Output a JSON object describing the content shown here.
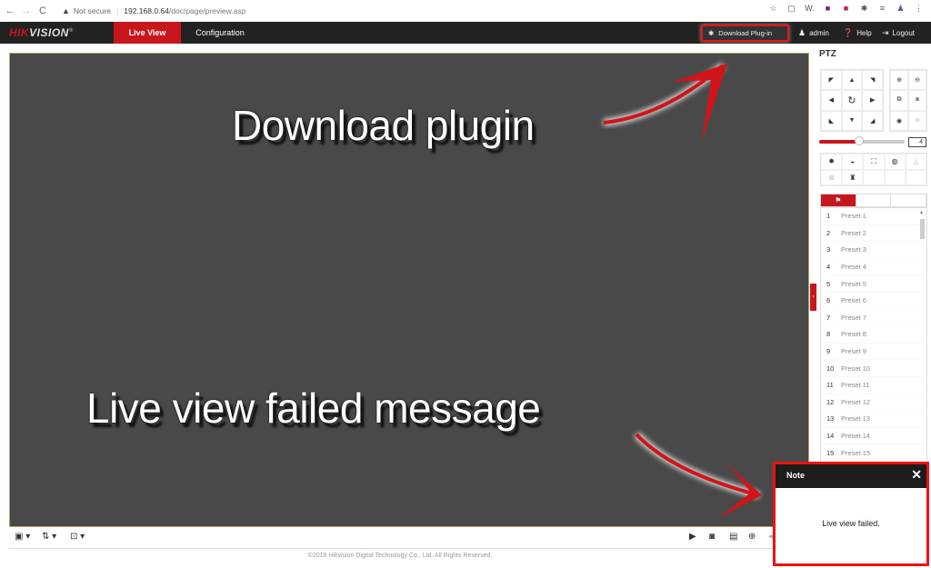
{
  "browser": {
    "back_icon": "←",
    "forward_icon": "→",
    "reload_icon": "C",
    "security_label": "Not secure",
    "url_host": "192.168.0.64",
    "url_path": "/doc/page/preview.asp",
    "extensions": [
      "☆",
      "▢",
      "W.",
      "■",
      "■",
      "✱",
      "≡",
      "♟",
      "⋮"
    ]
  },
  "header": {
    "logo_red": "HIK",
    "logo_rest": "VISION",
    "logo_reg": "®",
    "tabs": [
      {
        "label": "Live View",
        "active": true
      },
      {
        "label": "Configuration",
        "active": false
      }
    ],
    "download_plugin": "Download Plug-in",
    "user": "admin",
    "help": "Help",
    "logout": "Logout"
  },
  "annotations": {
    "top": "Download plugin",
    "bottom": "Live view failed message"
  },
  "ptz": {
    "title": "PTZ",
    "pad": [
      "◤",
      "▲",
      "◥",
      "◀",
      "↻",
      "▶",
      "◣",
      "▼",
      "◢"
    ],
    "zoom_buttons": [
      "⊕",
      "⊖",
      "⧉",
      "⧈",
      "◉",
      "○"
    ],
    "speed_value": "4",
    "speed_fraction": 0.47,
    "functions": [
      "✹",
      "◒",
      "⛶",
      "◍",
      "◬",
      "⊗",
      "♜",
      "",
      "",
      ""
    ],
    "preset_tab_icon": "⚑",
    "presets": [
      {
        "num": "1",
        "label": "Preset 1"
      },
      {
        "num": "2",
        "label": "Preset 2"
      },
      {
        "num": "3",
        "label": "Preset 3"
      },
      {
        "num": "4",
        "label": "Preset 4"
      },
      {
        "num": "5",
        "label": "Preset 5"
      },
      {
        "num": "6",
        "label": "Preset 6"
      },
      {
        "num": "7",
        "label": "Preset 7"
      },
      {
        "num": "8",
        "label": "Preset 8"
      },
      {
        "num": "9",
        "label": "Preset 9"
      },
      {
        "num": "10",
        "label": "Preset 10"
      },
      {
        "num": "11",
        "label": "Preset 11"
      },
      {
        "num": "12",
        "label": "Preset 12"
      },
      {
        "num": "13",
        "label": "Preset 13"
      },
      {
        "num": "14",
        "label": "Preset 14"
      },
      {
        "num": "15",
        "label": "Preset 15"
      }
    ]
  },
  "toolbar": {
    "left": [
      "▣ ▾",
      "⇅ ▾",
      "⊡ ▾"
    ],
    "right": [
      "▶",
      "◙",
      "▤",
      "⊕",
      "◂"
    ]
  },
  "footer": "©2019 Hikvision Digital Technology Co., Ltd. All Rights Reserved.",
  "note": {
    "title": "Note",
    "close": "✕",
    "message": "Live view failed."
  },
  "colors": {
    "brand_red": "#c8161d",
    "highlight_red": "#ee1111",
    "video_bg": "#494949"
  }
}
